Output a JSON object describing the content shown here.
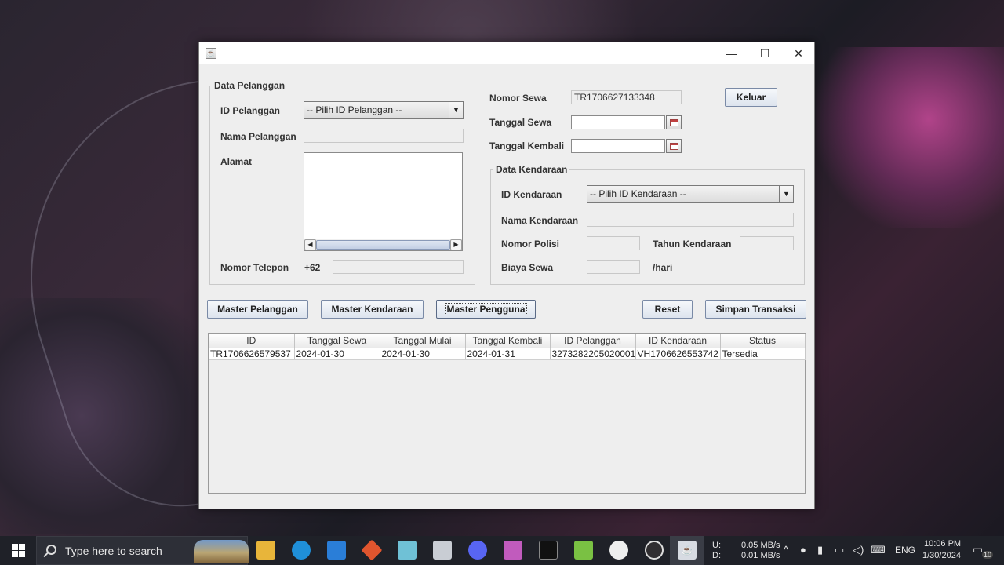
{
  "window": {
    "icon": "java-icon"
  },
  "pelanggan": {
    "group_title": "Data Pelanggan",
    "id_label": "ID Pelanggan",
    "id_combo": "-- Pilih ID Pelanggan --",
    "nama_label": "Nama Pelanggan",
    "nama_value": "",
    "alamat_label": "Alamat",
    "telepon_label": "Nomor Telepon",
    "telepon_prefix": "+62",
    "telepon_value": ""
  },
  "sewa": {
    "nomor_label": "Nomor Sewa",
    "nomor_value": "TR1706627133348",
    "tanggal_sewa_label": "Tanggal Sewa",
    "tanggal_kembali_label": "Tanggal Kembali",
    "keluar_button": "Keluar"
  },
  "kendaraan": {
    "group_title": "Data Kendaraan",
    "id_label": "ID Kendaraan",
    "id_combo": "-- Pilih ID Kendaraan --",
    "nama_label": "Nama Kendaraan",
    "nopol_label": "Nomor Polisi",
    "tahun_label": "Tahun Kendaraan",
    "biaya_label": "Biaya Sewa",
    "biaya_suffix": "/hari"
  },
  "actions": {
    "master_pelanggan": "Master Pelanggan",
    "master_kendaraan": "Master Kendaraan",
    "master_pengguna": "Master Pengguna",
    "reset": "Reset",
    "simpan": "Simpan Transaksi"
  },
  "table": {
    "columns": [
      "ID",
      "Tanggal Sewa",
      "Tanggal Mulai",
      "Tanggal Kembali",
      "ID Pelanggan",
      "ID Kendaraan",
      "Status"
    ],
    "rows": [
      [
        "TR1706626579537",
        "2024-01-30",
        "2024-01-30",
        "2024-01-31",
        "3273282205020001",
        "VH1706626553742",
        "Tersedia"
      ]
    ]
  },
  "taskbar": {
    "search_placeholder": "Type here to search",
    "net_up_label": "U:",
    "net_down_label": "D:",
    "net_up": "0.05 MB/s",
    "net_down": "0.01 MB/s",
    "language": "ENG",
    "time": "10:06 PM",
    "date": "1/30/2024",
    "notification_count": "10",
    "apps": [
      "file-explorer-icon",
      "edge-icon",
      "vscode-icon",
      "git-icon",
      "notepad-icon",
      "remote-icon",
      "discord-icon",
      "app-icon",
      "terminal-icon",
      "notepadpp-icon",
      "chrome-icon",
      "obs-icon",
      "java-icon"
    ]
  }
}
